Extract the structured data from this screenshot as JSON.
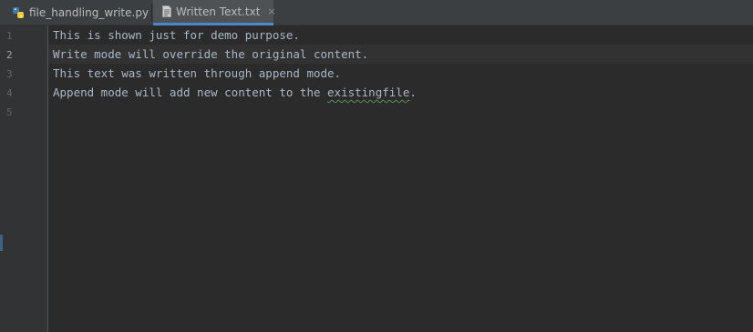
{
  "tabs": [
    {
      "label": "file_handling_write.py",
      "icon": "python-file-icon",
      "active": false
    },
    {
      "label": "Written Text.txt",
      "icon": "text-file-icon",
      "active": true
    }
  ],
  "tab_close_glyph": "×",
  "colors": {
    "background": "#2b2b2b",
    "gutter": "#313335",
    "text": "#a9b7c6",
    "active_tab_accent": "#4a88c7"
  },
  "editor": {
    "line_numbers": [
      "1",
      "2",
      "3",
      "4",
      "5"
    ],
    "current_line": 2,
    "lines": [
      {
        "text": "This is shown just for demo purpose."
      },
      {
        "text": "Write mode will override the original content."
      },
      {
        "text": "This text was written through append mode."
      },
      {
        "prefix": "Append mode will add new content to the ",
        "flagged": "existingfile",
        "suffix": "."
      },
      {
        "text": ""
      }
    ]
  }
}
